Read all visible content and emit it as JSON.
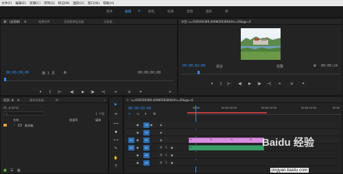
{
  "menu": [
    "文件(F)",
    "编辑(E)",
    "剪辑(C)",
    "序列(S)",
    "标记(M)",
    "图形(G)",
    "窗口(W)",
    "帮助(H)"
  ],
  "workspaces": [
    "组件",
    "编辑",
    "颜色",
    "效果",
    "音频",
    "图形",
    "库"
  ],
  "ws_menu_glyph": "≡",
  "source_panel": {
    "tabs": [
      "源：(无剪辑)",
      "效果控件",
      "音频剪辑混合器",
      "元数据"
    ],
    "tab_menu_glyph": "≡",
    "timecode_in": "00;00;00;00",
    "page_select": "第 1 页",
    "timecode_out": "00;00;00;00"
  },
  "program_panel": {
    "title": "节目: u=930200389,4098058380&fm=26&gp=0",
    "timecode": "00:00:02:08",
    "fit": "适合",
    "quality": "完整",
    "duration": "00:00:24"
  },
  "transport": [
    "▾",
    "{",
    "|←",
    "◀|",
    "▶",
    "|▶",
    "→|",
    "⇥",
    "⇲",
    "⌗"
  ],
  "project_panel": {
    "tabs": [
      "项目: 未",
      "媒体浏览器",
      "库"
    ],
    "tab_more": "»",
    "name": "Hj.prproj",
    "search_placeholder": "",
    "item_count": "1 个项",
    "col_name": "名称",
    "col_rate": "帧速率",
    "col_media": "媒体",
    "items": [
      {
        "name": "素材箱"
      }
    ]
  },
  "timeline": {
    "title": "u=930200389,4098058380&fm=26&gp=0",
    "timecode": "00:00:02:08",
    "ruler_labels": [
      "00:00",
      "00:00:05:00",
      "00:00:10:00",
      "00:00:15:00",
      "00:00"
    ],
    "video_tracks": [
      "V3",
      "V2",
      "V1"
    ],
    "audio_tracks": [
      "A1",
      "A2",
      "A3"
    ],
    "fx_label": "fx"
  },
  "tools": [
    "▶",
    "⇹",
    "⟺",
    "◆",
    "⟷",
    "✎",
    "✋",
    "T"
  ],
  "watermark": "Baidu 经验",
  "watermark_url": "jingyan.baidu.com",
  "colors": {
    "accent": "#2f8fef",
    "video_clip": "#d98de0",
    "audio_clip": "#3a9e68"
  }
}
